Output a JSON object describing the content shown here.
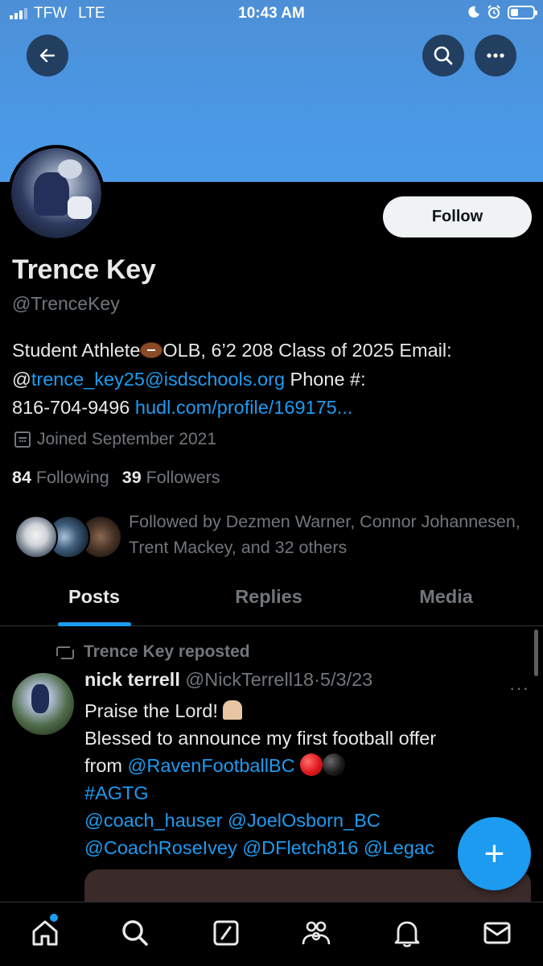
{
  "status_bar": {
    "carrier": "TFW",
    "network": "LTE",
    "time": "10:43 AM"
  },
  "profile": {
    "name": "Trence Key",
    "handle": "@TrenceKey",
    "follow_label": "Follow",
    "bio": {
      "part1": "Student Athlete",
      "part2": "OLB, 6’2 208 Class of 2025 Email:",
      "at": "@",
      "email_link": "trence_key25@isdschools.org",
      "phone_label": " Phone #:",
      "phone": "816-704-9496",
      "url": "hudl.com/profile/169175..."
    },
    "joined": "Joined September 2021",
    "following_count": "84",
    "following_label": "Following",
    "followers_count": "39",
    "followers_label": "Followers",
    "followed_by": "Followed by Dezmen Warner, Connor Johannesen, Trent Mackey, and 32 others"
  },
  "tabs": [
    {
      "label": "Posts"
    },
    {
      "label": "Replies"
    },
    {
      "label": "Media"
    }
  ],
  "post": {
    "repost_label": "Trence Key reposted",
    "author_name": "nick terrell",
    "author_handle": "@NickTerrell18",
    "separator": "·",
    "date": "5/3/23",
    "more": "···",
    "line1": "Praise the Lord!",
    "line2": "Blessed to announce my first football offer",
    "line3_prefix": "from ",
    "line3_mention": "@RavenFootballBC",
    "hashtag": "#AGTG",
    "line5": "@coach_hauser @JoelOsborn_BC",
    "line6": "@CoachRoseIvey @DFletch816 @Legac"
  },
  "fab_label": "+",
  "icons": {
    "back": "back-arrow-icon",
    "search": "search-icon",
    "more": "more-icon",
    "calendar": "calendar-icon",
    "repost": "repost-icon"
  },
  "colors": {
    "accent": "#1d9bf0",
    "banner": "#4a97e4",
    "background": "#000000",
    "muted": "#71767b"
  }
}
